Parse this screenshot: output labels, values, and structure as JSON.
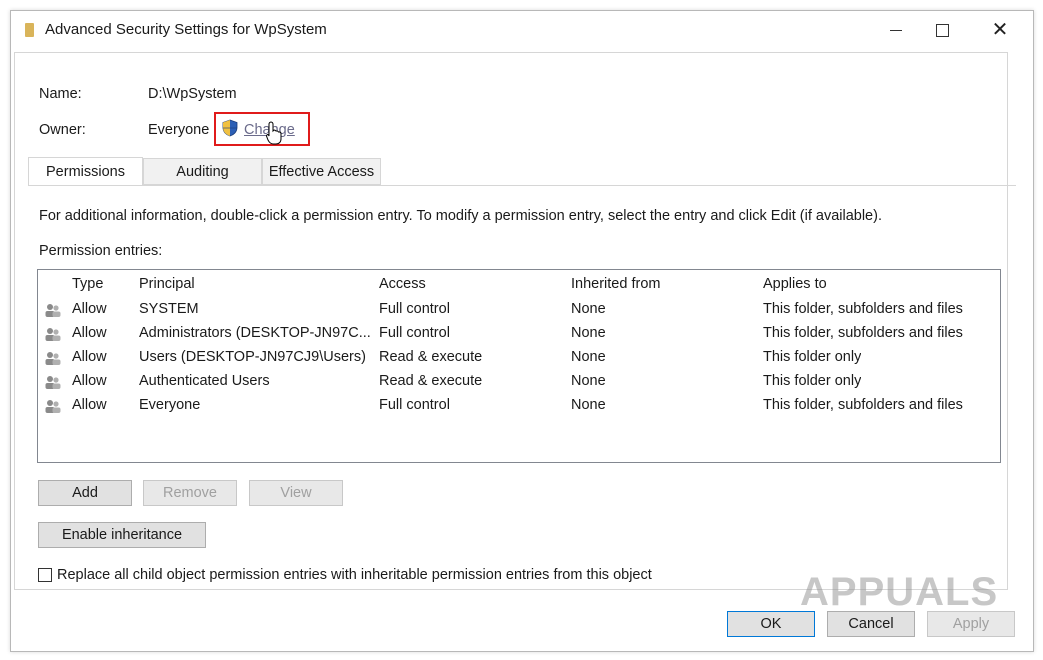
{
  "window": {
    "title": "Advanced Security Settings for WpSystem"
  },
  "object": {
    "name_label": "Name:",
    "name_value": "D:\\WpSystem",
    "owner_label": "Owner:",
    "owner_value": "Everyone",
    "change_link": "Change"
  },
  "tabs": [
    {
      "label": "Permissions",
      "active": true
    },
    {
      "label": "Auditing",
      "active": false
    },
    {
      "label": "Effective Access",
      "active": false
    }
  ],
  "permissions": {
    "info_text": "For additional information, double-click a permission entry. To modify a permission entry, select the entry and click Edit (if available).",
    "entries_label": "Permission entries:",
    "columns": [
      "Type",
      "Principal",
      "Access",
      "Inherited from",
      "Applies to"
    ],
    "rows": [
      {
        "type": "Allow",
        "principal": "SYSTEM",
        "access": "Full control",
        "inherited": "None",
        "applies": "This folder, subfolders and files"
      },
      {
        "type": "Allow",
        "principal": "Administrators (DESKTOP-JN97C...",
        "access": "Full control",
        "inherited": "None",
        "applies": "This folder, subfolders and files"
      },
      {
        "type": "Allow",
        "principal": "Users (DESKTOP-JN97CJ9\\Users)",
        "access": "Read & execute",
        "inherited": "None",
        "applies": "This folder only"
      },
      {
        "type": "Allow",
        "principal": "Authenticated Users",
        "access": "Read & execute",
        "inherited": "None",
        "applies": "This folder only"
      },
      {
        "type": "Allow",
        "principal": "Everyone",
        "access": "Full control",
        "inherited": "None",
        "applies": "This folder, subfolders and files"
      }
    ],
    "add_label": "Add",
    "remove_label": "Remove",
    "view_label": "View",
    "enable_inheritance_label": "Enable inheritance",
    "replace_checkbox_label": "Replace all child object permission entries with inheritable permission entries from this object"
  },
  "footer": {
    "ok_label": "OK",
    "cancel_label": "Cancel",
    "apply_label": "Apply"
  },
  "watermark": "APPUALS",
  "colors": {
    "highlight": "#e01b1b",
    "link": "#6a6a8a",
    "disabled_text": "#a0a0a0"
  }
}
